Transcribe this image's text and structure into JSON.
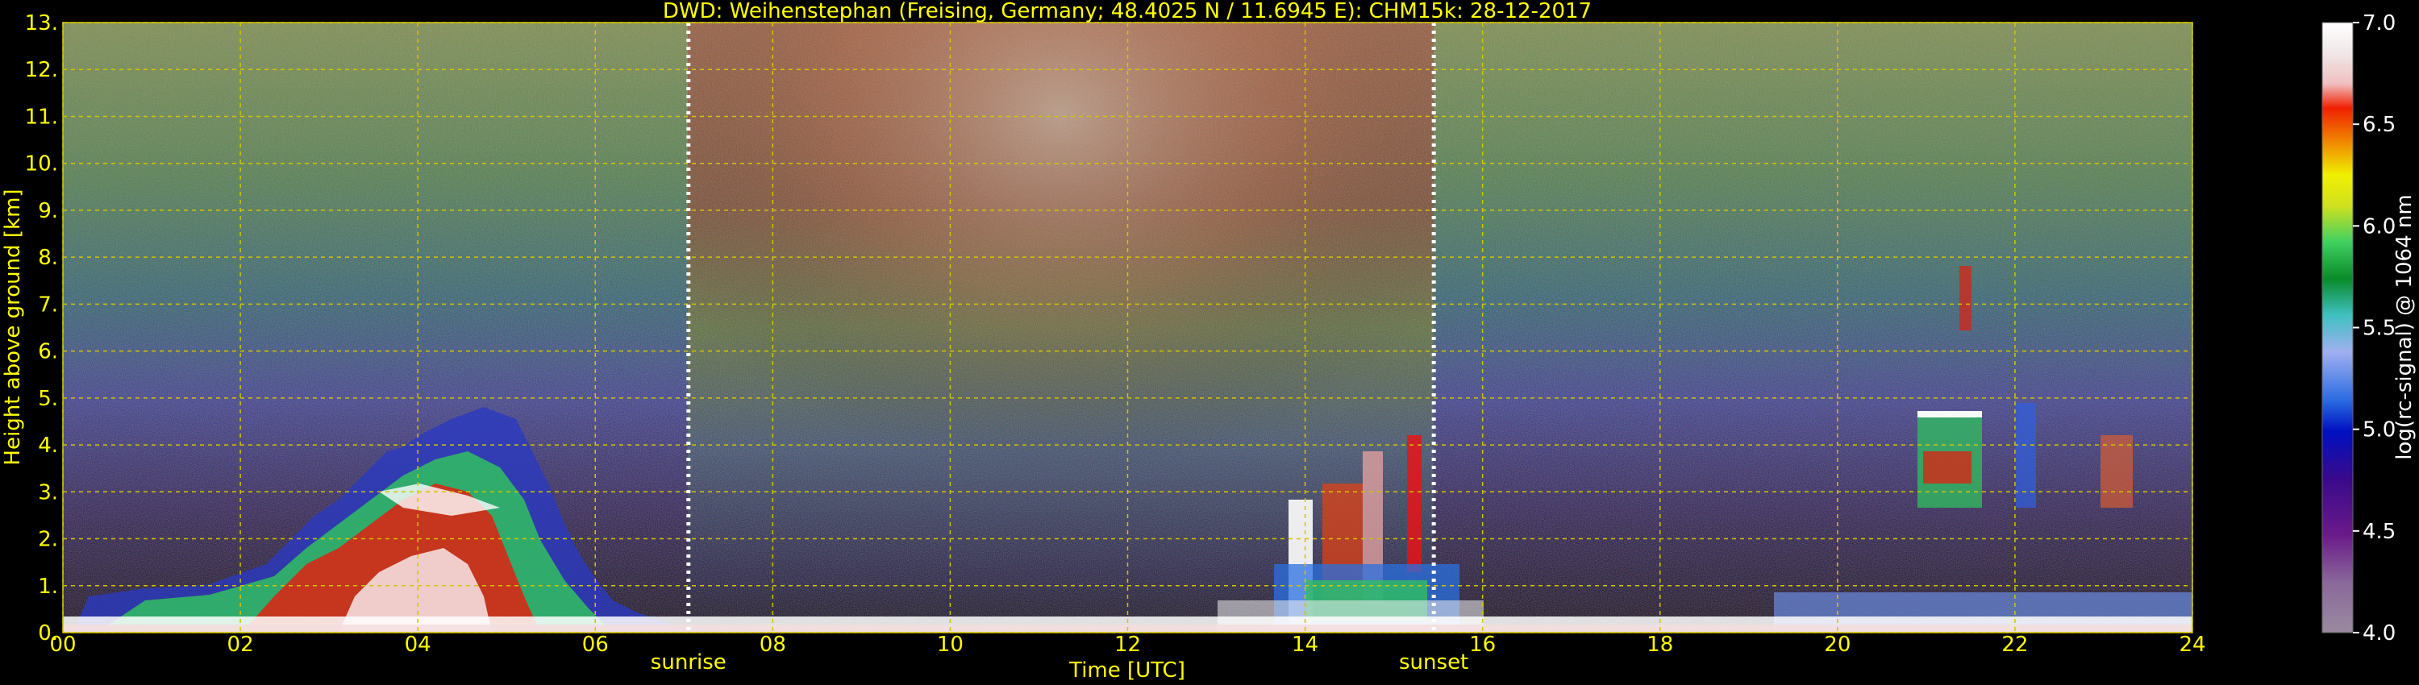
{
  "chart_data": {
    "type": "heatmap",
    "title": "DWD: Weihenstephan (Freising, Germany; 48.4025 N / 11.6945 E):    CHM15k: 28-12-2017",
    "xlabel": "Time [UTC]",
    "ylabel": "Height above ground [km]",
    "xlim": [
      0,
      24
    ],
    "ylim": [
      0,
      13
    ],
    "x_ticks": [
      "00",
      "02",
      "04",
      "06",
      "08",
      "10",
      "12",
      "14",
      "16",
      "18",
      "20",
      "22",
      "24"
    ],
    "y_ticks": [
      "0.",
      "1.",
      "2.",
      "3.",
      "4.",
      "5.",
      "6.",
      "7.",
      "8.",
      "9.",
      "10.",
      "11.",
      "12.",
      "13."
    ],
    "grid": true,
    "annotations": [
      {
        "label": "sunrise",
        "x": 7.05
      },
      {
        "label": "sunset",
        "x": 15.45
      }
    ],
    "colorbar": {
      "label": "log(rc-signal) @ 1064 nm",
      "range": [
        4.0,
        7.0
      ],
      "ticks": [
        "4.0",
        "4.5",
        "5.0",
        "5.5",
        "6.0",
        "6.5",
        "7.0"
      ]
    },
    "features": [
      {
        "name": "surface layer",
        "x_range": [
          0,
          24
        ],
        "height_km": [
          0,
          0.4
        ]
      },
      {
        "name": "morning aerosol/cloud layer",
        "x_range": [
          1.0,
          6.0
        ],
        "height_km": [
          0.3,
          4.0
        ]
      },
      {
        "name": "afternoon cloud columns",
        "x_range": [
          13.8,
          15.2
        ],
        "height_km": [
          0.5,
          4.2
        ]
      },
      {
        "name": "night cloud layer",
        "x_range": [
          20.8,
          23.5
        ],
        "height_km": [
          2.6,
          7.8
        ]
      }
    ]
  },
  "colors": {
    "label_color": "#ffff00",
    "grid_color": "#d4c400",
    "background": "#000000"
  }
}
